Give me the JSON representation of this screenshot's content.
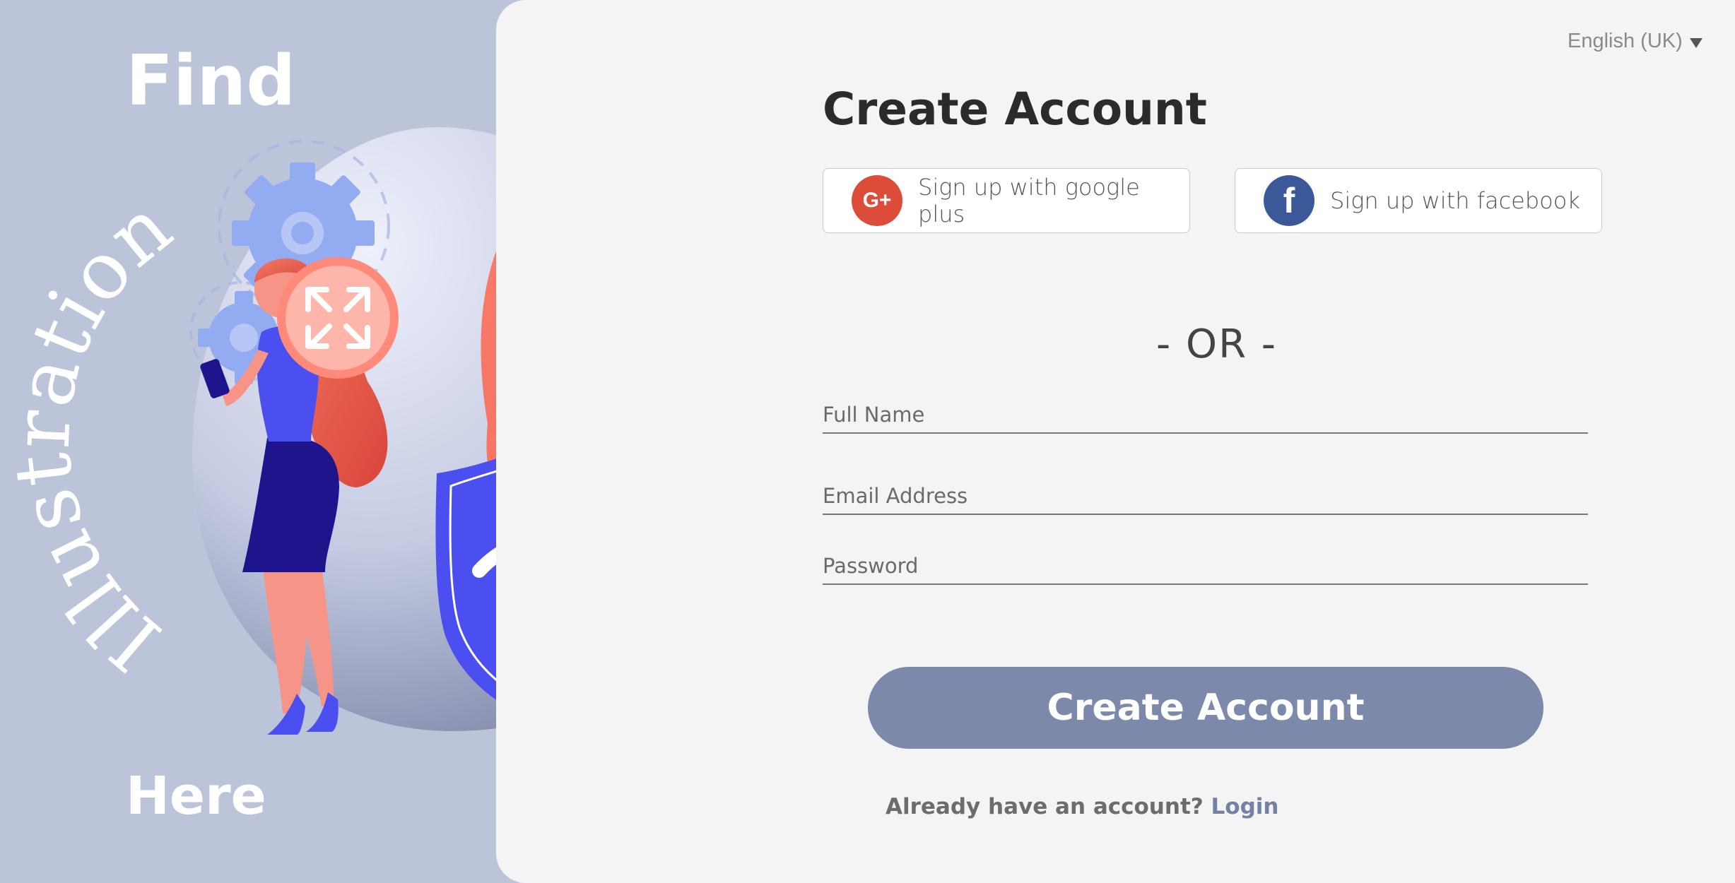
{
  "illustration": {
    "title_top": "Find",
    "title_arc": "Illustration",
    "title_bottom": "Here"
  },
  "header": {
    "language": "English (UK)"
  },
  "form": {
    "title": "Create Account",
    "google_label": "Sign up with google plus",
    "google_icon_text": "G+",
    "facebook_label": "Sign up with facebook",
    "facebook_icon_text": "f",
    "or_text": "- OR -",
    "fields": {
      "full_name_placeholder": "Full Name",
      "email_placeholder": "Email Address",
      "password_placeholder": "Password"
    },
    "submit_label": "Create Account",
    "login_prompt": "Already have an account?",
    "login_link": "Login"
  },
  "colors": {
    "left_background": "#bcc4da",
    "card_background": "#f4f4f4",
    "submit_button": "#7d89ab",
    "login_link": "#7480a4",
    "google_red": "#dd4b39",
    "facebook_blue": "#3b5998",
    "shield_blue": "#4c4ff0",
    "leaf_coral": "#f97b6c"
  }
}
